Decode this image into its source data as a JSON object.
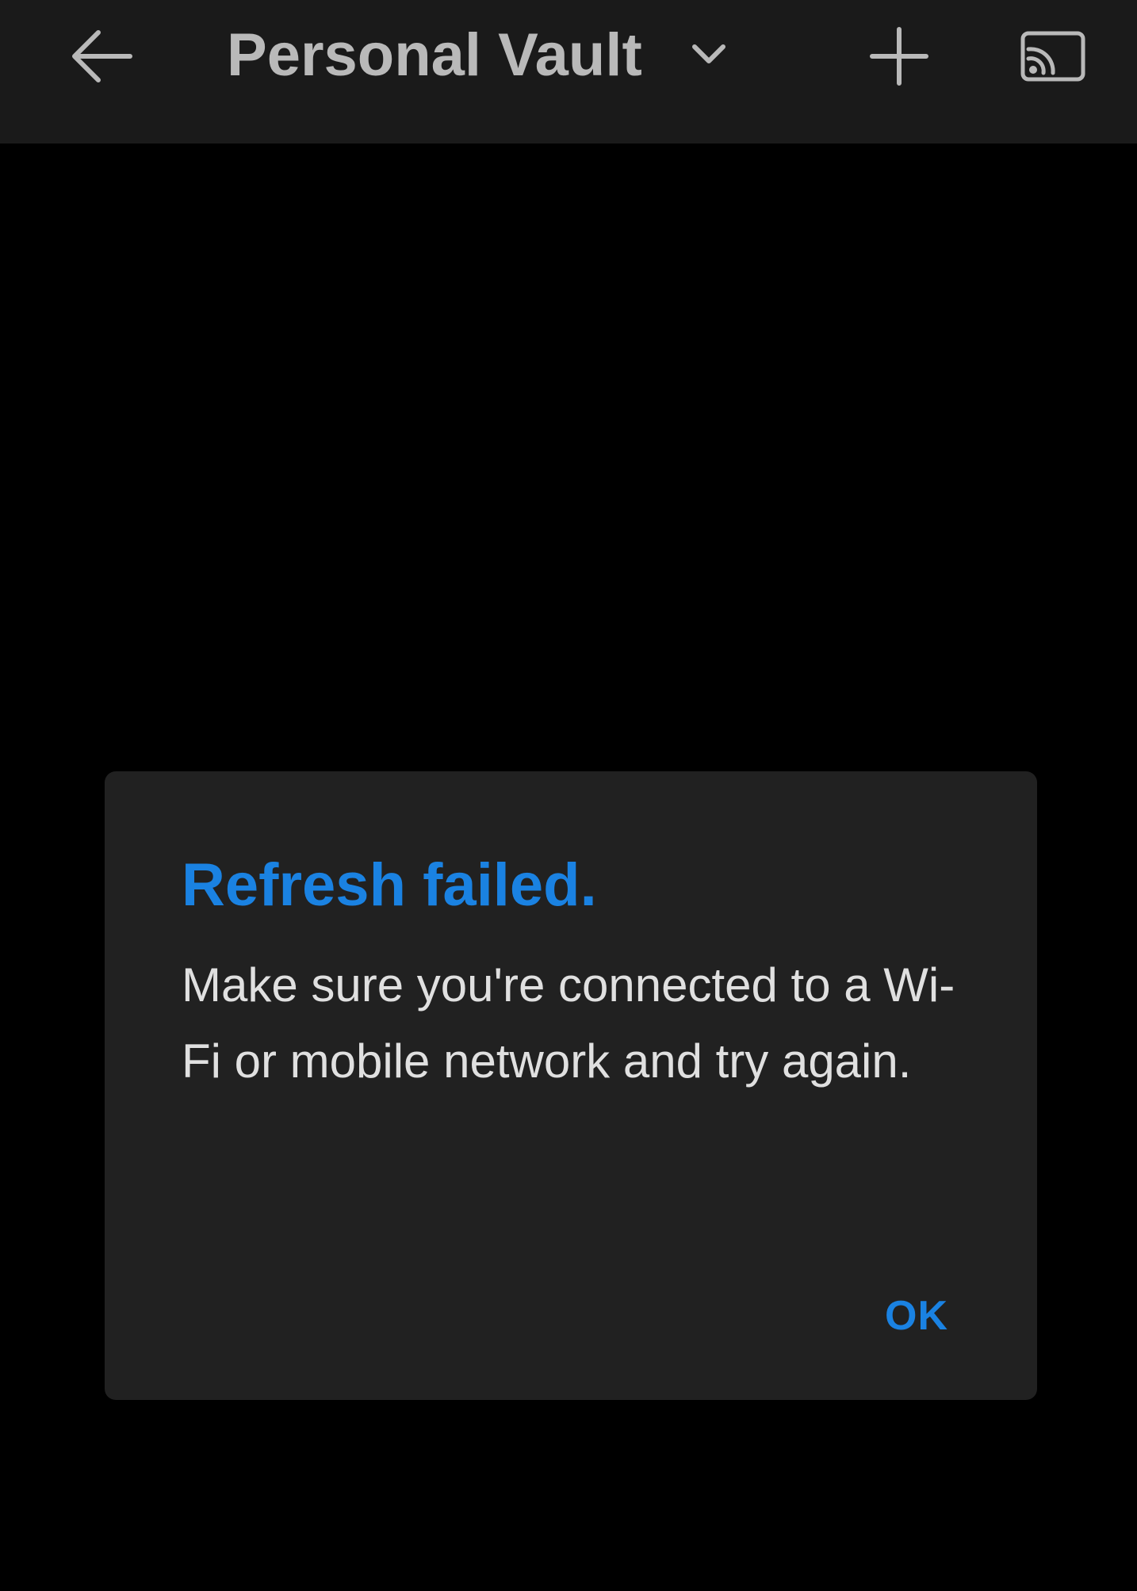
{
  "app_bar": {
    "title": "Personal Vault",
    "back_icon": "arrow-left-icon",
    "dropdown_icon": "chevron-down-icon",
    "add_icon": "plus-icon",
    "cast_icon": "cast-icon"
  },
  "dialog": {
    "title": "Refresh failed.",
    "message": "Make sure you're connected to a Wi-Fi or mobile network and try again.",
    "ok_label": "OK"
  },
  "colors": {
    "accent": "#1a82e2",
    "app_bar_background": "#1a1a1a",
    "app_bar_foreground": "#b9b9b9",
    "dialog_background": "#212121",
    "dialog_text": "#e0e0e0",
    "screen_background": "#000000"
  }
}
